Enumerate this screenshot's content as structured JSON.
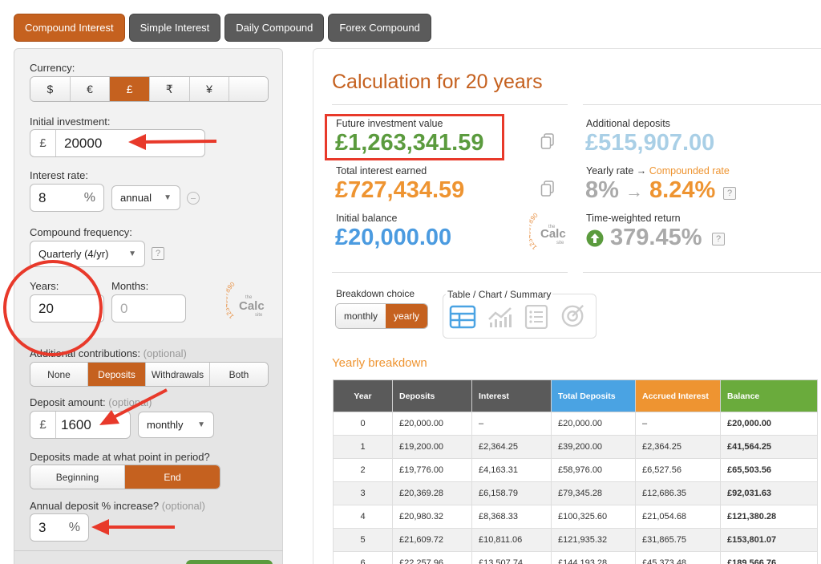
{
  "tabs": [
    "Compound Interest",
    "Simple Interest",
    "Daily Compound",
    "Forex Compound"
  ],
  "left": {
    "currency_label": "Currency:",
    "currencies": [
      "$",
      "€",
      "£",
      "₹",
      "¥",
      ""
    ],
    "selected_currency": "£",
    "initial_label": "Initial investment:",
    "initial_prefix": "£",
    "initial_value": "20000",
    "rate_label": "Interest rate:",
    "rate_value": "8",
    "rate_suffix": "%",
    "rate_period": "annual",
    "freq_label": "Compound frequency:",
    "freq_value": "Quarterly (4/yr)",
    "qmark": "?",
    "years_label": "Years:",
    "years_value": "20",
    "months_label": "Months:",
    "months_placeholder": "0",
    "logo_text": "Calc",
    "logo_the": "the",
    "logo_site": "site",
    "logo_digits": "1234567890",
    "contrib_label": "Additional contributions:",
    "contrib_optional": "(optional)",
    "contrib_options": [
      "None",
      "Deposits",
      "Withdrawals",
      "Both"
    ],
    "contrib_selected": "Deposits",
    "deposit_label": "Deposit amount:",
    "deposit_optional": "(optional)",
    "deposit_prefix": "£",
    "deposit_value": "1600",
    "deposit_period": "monthly",
    "point_label": "Deposits made at what point in period?",
    "point_options": [
      "Beginning",
      "End"
    ],
    "point_selected": "End",
    "increase_label": "Annual deposit % increase?",
    "increase_optional": "(optional)",
    "increase_value": "3",
    "increase_suffix": "%"
  },
  "results": {
    "title": "Calculation for 20 years",
    "future_label": "Future investment value",
    "future_value": "£1,263,341.59",
    "interest_label": "Total interest earned",
    "interest_value": "£727,434.59",
    "initial_label": "Initial balance",
    "initial_value": "£20,000.00",
    "deposits_label": "Additional deposits",
    "deposits_value": "£515,907.00",
    "yearly_label": "Yearly rate →",
    "compounded_label": "Compounded rate",
    "yearly_rate": "8%",
    "arrow": "→",
    "compounded_rate": "8.24%",
    "twr_label": "Time-weighted return",
    "twr_value": "379.45%",
    "qmark": "?"
  },
  "breakdown": {
    "choice_label": "Breakdown choice",
    "choices": [
      "monthly",
      "yearly"
    ],
    "selected": "yearly",
    "view_label": "Table / Chart / Summary",
    "section_title": "Yearly breakdown"
  },
  "table": {
    "headers": [
      "Year",
      "Deposits",
      "Interest",
      "Total Deposits",
      "Accrued Interest",
      "Balance"
    ],
    "rows": [
      [
        "0",
        "£20,000.00",
        "–",
        "£20,000.00",
        "–",
        "£20,000.00"
      ],
      [
        "1",
        "£19,200.00",
        "£2,364.25",
        "£39,200.00",
        "£2,364.25",
        "£41,564.25"
      ],
      [
        "2",
        "£19,776.00",
        "£4,163.31",
        "£58,976.00",
        "£6,527.56",
        "£65,503.56"
      ],
      [
        "3",
        "£20,369.28",
        "£6,158.79",
        "£79,345.28",
        "£12,686.35",
        "£92,031.63"
      ],
      [
        "4",
        "£20,980.32",
        "£8,368.33",
        "£100,325.60",
        "£21,054.68",
        "£121,380.28"
      ],
      [
        "5",
        "£21,609.72",
        "£10,811.06",
        "£121,935.32",
        "£31,865.75",
        "£153,801.07"
      ],
      [
        "6",
        "£22,257.96",
        "£13,507.74",
        "£144,193.28",
        "£45,373.48",
        "£189,566.76"
      ]
    ]
  },
  "colors": {
    "accent": "#c5611f",
    "annotation": "#e8392a",
    "green": "#5b9b3e",
    "orange": "#ee9431",
    "blue": "#4b9be0"
  }
}
